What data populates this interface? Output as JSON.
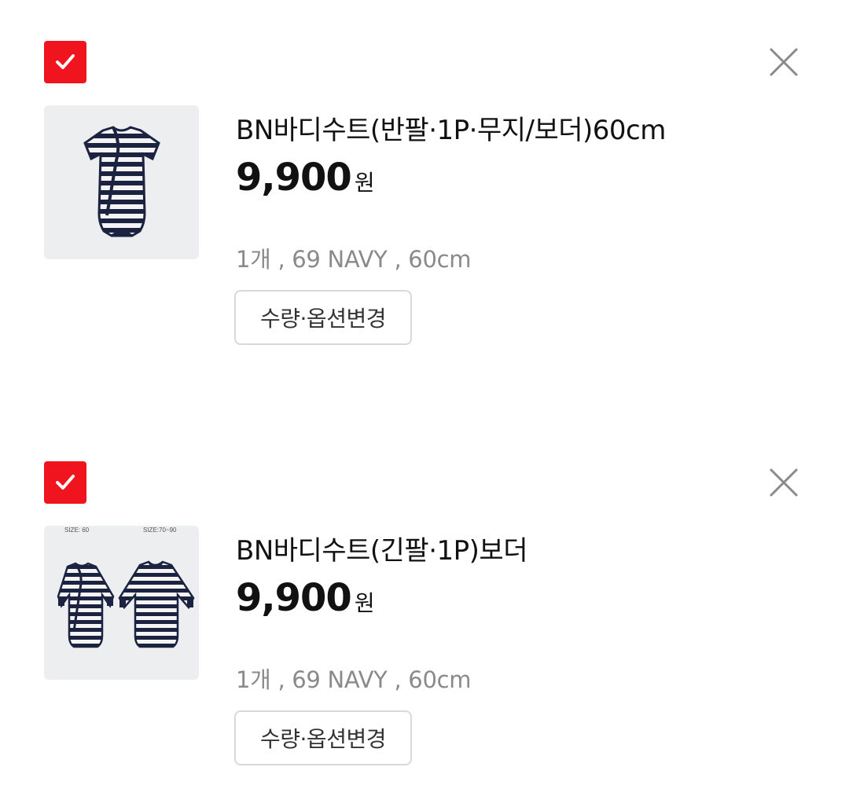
{
  "cart": {
    "items": [
      {
        "title": "BN바디수트(반팔·1P·무지/보더)60cm",
        "price": "9,900",
        "currency": "원",
        "options": "1개 , 69 NAVY , 60cm",
        "change_button": "수량·옵션변경",
        "checked": true
      },
      {
        "title": "BN바디수트(긴팔·1P)보더",
        "price": "9,900",
        "currency": "원",
        "options": "1개 , 69 NAVY , 60cm",
        "change_button": "수량·옵션변경",
        "checked": true,
        "image_labels": [
          "SIZE: 60",
          "SIZE:70~90"
        ]
      }
    ]
  },
  "colors": {
    "checkbox": "#f0141e",
    "close_icon": "#8a8a8a",
    "option_text": "#8a8a8a",
    "button_border": "#d9d9d9",
    "thumbnail_bg": "#eceeef",
    "navy": "#1c2340"
  },
  "icons": {
    "checkbox": "check-icon",
    "remove": "close-icon"
  }
}
